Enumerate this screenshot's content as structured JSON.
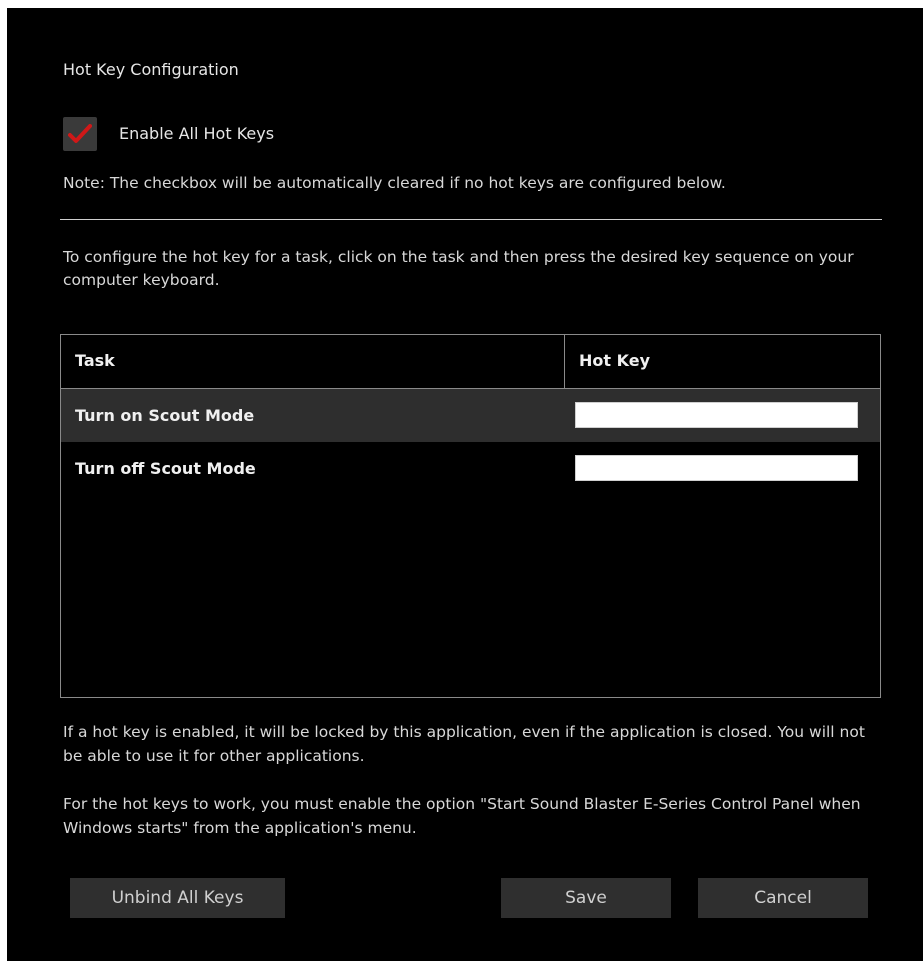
{
  "dialog": {
    "title": "Hot Key Configuration",
    "enable_all": {
      "label": "Enable All Hot Keys",
      "checked": true,
      "check_color": "#d01818"
    },
    "note": "Note: The checkbox will be automatically cleared if no hot keys are configured below.",
    "instruction": "To configure the hot key for a task, click on the task and then press the desired key sequence on your computer keyboard.",
    "table": {
      "columns": [
        "Task",
        "Hot Key"
      ],
      "rows": [
        {
          "task": "Turn on Scout Mode",
          "hot_key": "",
          "selected": true
        },
        {
          "task": "Turn off Scout Mode",
          "hot_key": "",
          "selected": false
        }
      ]
    },
    "info_lock": "If a hot key is enabled, it will be locked by this application, even if the application is closed. You will not be able to use it for other applications.",
    "info_startup": "For the hot keys to work, you must enable the option \"Start Sound Blaster E-Series Control Panel when Windows starts\" from the application's menu.",
    "buttons": {
      "unbind": "Unbind All Keys",
      "save": "Save",
      "cancel": "Cancel"
    }
  },
  "colors": {
    "background": "#000000",
    "text": "#d8d8d8",
    "selected_row": "#2e2e2e",
    "button": "#2f2f2f",
    "accent_check": "#d01818"
  }
}
